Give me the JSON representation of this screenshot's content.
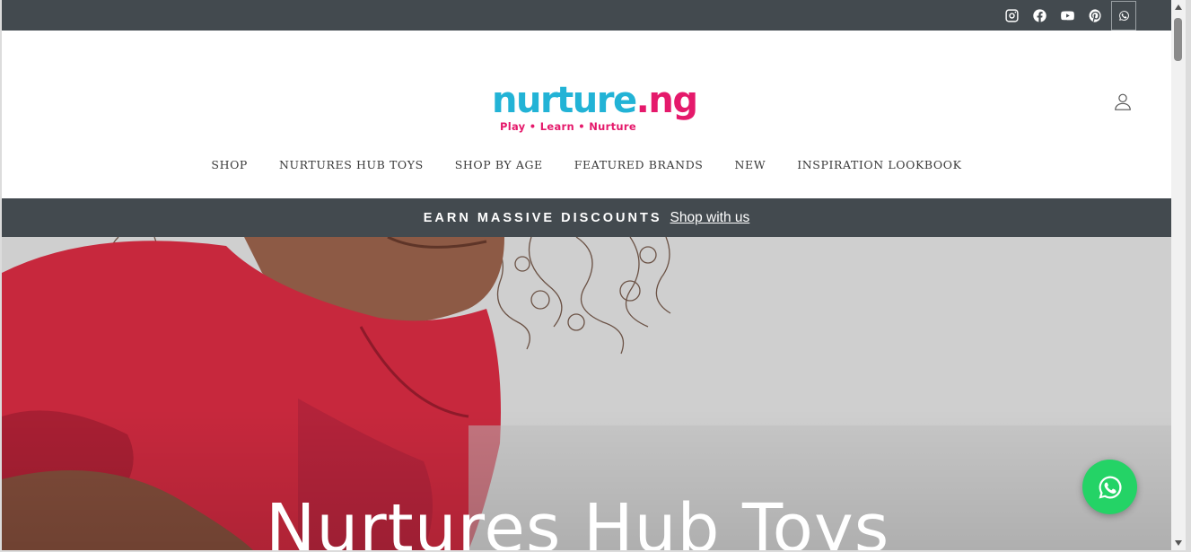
{
  "social": {
    "icons": [
      "instagram-icon",
      "facebook-icon",
      "youtube-icon",
      "pinterest-icon",
      "whatsapp-icon"
    ]
  },
  "logo": {
    "word_a": "nurture",
    "word_b": ".ng",
    "tagline": "Play • Learn • Nurture"
  },
  "nav": {
    "items": [
      "SHOP",
      "NURTURES HUB TOYS",
      "SHOP BY AGE",
      "FEATURED BRANDS",
      "NEW",
      "INSPIRATION LOOKBOOK"
    ]
  },
  "announcement": {
    "text": "EARN MASSIVE DISCOUNTS",
    "link": "Shop with us"
  },
  "hero": {
    "title": "Nurtures Hub Toys"
  },
  "colors": {
    "bar": "#434a4f",
    "brand_teal": "#22b3d6",
    "brand_pink": "#e5196b",
    "whatsapp_green": "#24d366"
  }
}
